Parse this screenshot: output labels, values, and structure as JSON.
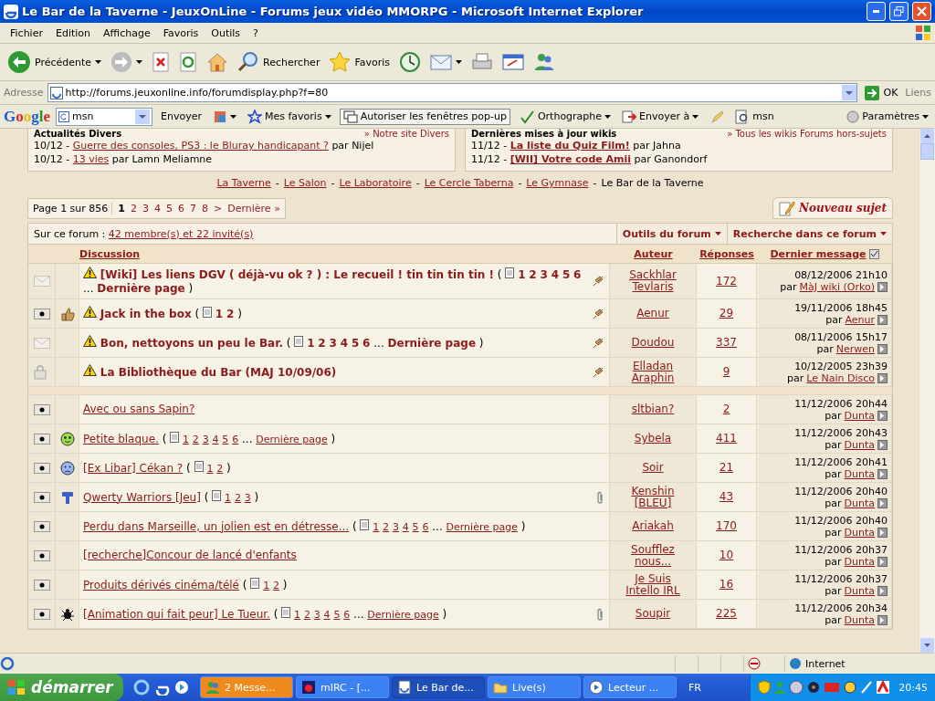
{
  "window": {
    "title": "Le Bar de la Taverne - JeuxOnLine - Forums jeux vidéo MMORPG - Microsoft Internet Explorer"
  },
  "menu": [
    "Fichier",
    "Edition",
    "Affichage",
    "Favoris",
    "Outils",
    "?"
  ],
  "toolbar": [
    {
      "kind": "back",
      "label": "Précédente",
      "caret": true
    },
    {
      "kind": "forward",
      "caret": true
    },
    {
      "kind": "stop"
    },
    {
      "kind": "refresh"
    },
    {
      "kind": "home"
    },
    {
      "kind": "search",
      "label": "Rechercher"
    },
    {
      "kind": "favorites",
      "label": "Favoris"
    },
    {
      "kind": "history"
    },
    {
      "kind": "mail",
      "caret": true
    },
    {
      "kind": "print"
    },
    {
      "kind": "edit"
    },
    {
      "kind": "messenger"
    }
  ],
  "address": {
    "label": "Adresse",
    "url": "http://forums.jeuxonline.info/forumdisplay.php?f=80",
    "go": "OK",
    "links": "Liens"
  },
  "google_bar": {
    "logo": "Google",
    "search": "msn",
    "items": [
      {
        "kind": "send",
        "label": "Envoyer"
      },
      {
        "kind": "puzzle",
        "caret": true
      },
      {
        "kind": "star",
        "label": "Mes favoris",
        "caret": true
      },
      {
        "kind": "popup",
        "label": "Autoriser les fenêtres pop-up"
      },
      {
        "kind": "spell",
        "label": "Orthographe",
        "caret": true
      },
      {
        "kind": "sendto",
        "label": "Envoyer à",
        "caret": true
      },
      {
        "kind": "highlight"
      },
      {
        "kind": "find",
        "label": "msn"
      }
    ],
    "settings": "Paramètres"
  },
  "news": [
    {
      "title": "Actualités Divers",
      "link": "» Notre site Divers",
      "items": [
        {
          "date": "10/12 -",
          "title": "Guerre des consoles, PS3 : le Bluray handicapant ?",
          "by": "par",
          "author": "Nijel",
          "bold": false
        },
        {
          "date": "10/12 -",
          "title": "13 vies",
          "by": "par",
          "author": "Lamn Meliamne",
          "bold": false
        }
      ]
    },
    {
      "title": "Dernières mises à jour wikis",
      "link": "» Tous les wikis Forums hors-sujets",
      "items": [
        {
          "date": "11/12 -",
          "title": "La liste du Quiz Film!",
          "by": "par",
          "author": "Jahna",
          "bold": true
        },
        {
          "date": "11/12 -",
          "title": "[WII] Votre code Amii",
          "by": "par",
          "author": "Ganondorf",
          "bold": true
        }
      ]
    }
  ],
  "breadcrumb": [
    {
      "kind": "link",
      "text": "La Taverne"
    },
    {
      "kind": "sep",
      "text": "-"
    },
    {
      "kind": "link",
      "text": "Le Salon"
    },
    {
      "kind": "sep",
      "text": "-"
    },
    {
      "kind": "link",
      "text": "Le Laboratoire"
    },
    {
      "kind": "sep",
      "text": "-"
    },
    {
      "kind": "link",
      "text": "Le Cercle Taberna"
    },
    {
      "kind": "sep",
      "text": "-"
    },
    {
      "kind": "link",
      "text": "Le Gymnase"
    },
    {
      "kind": "sep",
      "text": "-"
    },
    {
      "kind": "current",
      "text": "Le Bar de la Taverne"
    }
  ],
  "pagination": {
    "label": "Page 1 sur 856",
    "pages": [
      {
        "label": "1",
        "selected": true
      },
      {
        "label": "2",
        "selected": false
      },
      {
        "label": "3",
        "selected": false
      },
      {
        "label": "4",
        "selected": false
      },
      {
        "label": "5",
        "selected": false
      },
      {
        "label": "6",
        "selected": false
      },
      {
        "label": "7",
        "selected": false
      },
      {
        "label": "8",
        "selected": false
      }
    ],
    "next": ">",
    "last": "Dernière »"
  },
  "new_topic": "Nouveau sujet",
  "forum_bar": {
    "online_label": "Sur ce forum :",
    "online_link": "42 membre(s) et 22 invité(s)",
    "tools": [
      "Outils du forum",
      "Recherche dans ce forum"
    ]
  },
  "columns": [
    "Discussion",
    "Auteur",
    "Réponses",
    "Dernier message"
  ],
  "sticky": [
    {
      "status": {
        "kind": "envelope"
      },
      "title": "[Wiki] Les liens DGV ( déjà-vu ok ? ) : Le recueil ! tin tin tin tin !",
      "pages": {
        "open": "(",
        "numbers": [
          "1",
          "2",
          "3",
          "4",
          "5",
          "6"
        ],
        "more": "...",
        "last": "Dernière page",
        "close": ")"
      },
      "pinned": true,
      "attachment": false,
      "author": "Sackhlar Tevlaris",
      "replies": "172",
      "date": "08/12/2006 21h10",
      "by": "par",
      "last_author": "MàJ wiki (Orko)"
    },
    {
      "status": {
        "kind": "dot"
      },
      "icon": {
        "kind": "thumb"
      },
      "title": "Jack in the box",
      "pages": {
        "open": "(",
        "numbers": [
          "1",
          "2"
        ],
        "close": ")"
      },
      "pinned": true,
      "attachment": false,
      "author": "Aenur",
      "replies": "29",
      "date": "19/11/2006 18h45",
      "by": "par",
      "last_author": "Aenur"
    },
    {
      "status": {
        "kind": "envelope"
      },
      "title": "Bon, nettoyons un peu le Bar.",
      "pages": {
        "open": "(",
        "numbers": [
          "1",
          "2",
          "3",
          "4",
          "5",
          "6"
        ],
        "more": "...",
        "last": "Dernière page",
        "close": ")"
      },
      "pinned": true,
      "attachment": false,
      "author": "Doudou",
      "replies": "337",
      "date": "08/11/2006 15h17",
      "by": "par",
      "last_author": "Nerwen"
    },
    {
      "status": {
        "kind": "lock"
      },
      "title": "La Bibliothèque du Bar (MAJ 10/09/06)",
      "pinned": true,
      "attachment": false,
      "author": "Elladan Araphin",
      "replies": "9",
      "date": "10/12/2005 23h39",
      "by": "par",
      "last_author": "Le Nain Disco"
    }
  ],
  "threads": [
    {
      "status": {
        "kind": "dot"
      },
      "title": "Avec ou sans Sapin?",
      "pinned": false,
      "attachment": false,
      "author": "sltbian?",
      "replies": "2",
      "date": "11/12/2006 20h44",
      "by": "par",
      "last_author": "Dunta"
    },
    {
      "status": {
        "kind": "dot"
      },
      "icon": {
        "kind": "smile"
      },
      "title": "Petite blaque.",
      "pages": {
        "open": "(",
        "numbers": [
          "1",
          "2",
          "3",
          "4",
          "5",
          "6"
        ],
        "more": "...",
        "last": "Dernière page",
        "close": ")"
      },
      "pinned": false,
      "attachment": false,
      "author": "Sybela",
      "replies": "411",
      "date": "11/12/2006 20h43",
      "by": "par",
      "last_author": "Dunta"
    },
    {
      "status": {
        "kind": "dot"
      },
      "icon": {
        "kind": "sad"
      },
      "title": "[Ex Libar] Cékan ?",
      "pages": {
        "open": "(",
        "numbers": [
          "1",
          "2"
        ],
        "close": ")"
      },
      "pinned": false,
      "attachment": false,
      "author": "Soir",
      "replies": "21",
      "date": "11/12/2006 20h41",
      "by": "par",
      "last_author": "Dunta"
    },
    {
      "status": {
        "kind": "dot"
      },
      "icon": {
        "kind": "hammer"
      },
      "title": "Qwerty Warriors [Jeu]",
      "pages": {
        "open": "(",
        "numbers": [
          "1",
          "2",
          "3"
        ],
        "close": ")"
      },
      "pinned": false,
      "attachment": true,
      "author": "Kenshin [BLEU]",
      "replies": "43",
      "date": "11/12/2006 20h40",
      "by": "par",
      "last_author": "Dunta"
    },
    {
      "status": {
        "kind": "dot"
      },
      "title": "Perdu dans Marseille, un jolien est en détresse...",
      "pages": {
        "open": "(",
        "numbers": [
          "1",
          "2",
          "3",
          "4",
          "5",
          "6"
        ],
        "more": "...",
        "last": "Dernière page",
        "close": ")"
      },
      "pinned": false,
      "attachment": false,
      "author": "Ariakah",
      "replies": "170",
      "date": "11/12/2006 20h40",
      "by": "par",
      "last_author": "Dunta"
    },
    {
      "status": {
        "kind": "dot"
      },
      "title": "[recherche]Concour de lancé d'enfants",
      "pinned": false,
      "attachment": false,
      "author": "Soufflez nous...",
      "replies": "10",
      "date": "11/12/2006 20h37",
      "by": "par",
      "last_author": "Dunta"
    },
    {
      "status": {
        "kind": "dot"
      },
      "title": "Produits dérivés cinéma/télé",
      "pages": {
        "open": "(",
        "numbers": [
          "1",
          "2"
        ],
        "close": ")"
      },
      "pinned": false,
      "attachment": false,
      "author": "Je Suis Intello IRL",
      "replies": "16",
      "date": "11/12/2006 20h37",
      "by": "par",
      "last_author": "Dunta"
    },
    {
      "status": {
        "kind": "dot"
      },
      "icon": {
        "kind": "spider"
      },
      "title": "[Animation qui fait peur] Le Tueur.",
      "pages": {
        "open": "(",
        "numbers": [
          "1",
          "2",
          "3",
          "4",
          "5",
          "6"
        ],
        "more": "...",
        "last": "Dernière page",
        "close": ")"
      },
      "pinned": false,
      "attachment": true,
      "author": "Soupir",
      "replies": "225",
      "date": "11/12/2006 20h34",
      "by": "par",
      "last_author": "Dunta"
    }
  ],
  "status_bar": {
    "zone": "Internet"
  },
  "taskbar": {
    "start": "démarrer",
    "tasks": [
      {
        "label": "2 Messe...",
        "kind": "messenger",
        "selected": false,
        "alert": true
      },
      {
        "label": "mIRC - [...",
        "kind": "irc",
        "selected": false,
        "alert": false
      },
      {
        "label": "Le Bar de...",
        "kind": "browser",
        "selected": true,
        "alert": false
      },
      {
        "label": "Live(s)",
        "kind": "folder",
        "selected": false,
        "alert": false
      },
      {
        "label": "Lecteur ...",
        "kind": "player",
        "selected": false,
        "alert": false
      }
    ],
    "lang": "FR",
    "clock": "20:45"
  }
}
